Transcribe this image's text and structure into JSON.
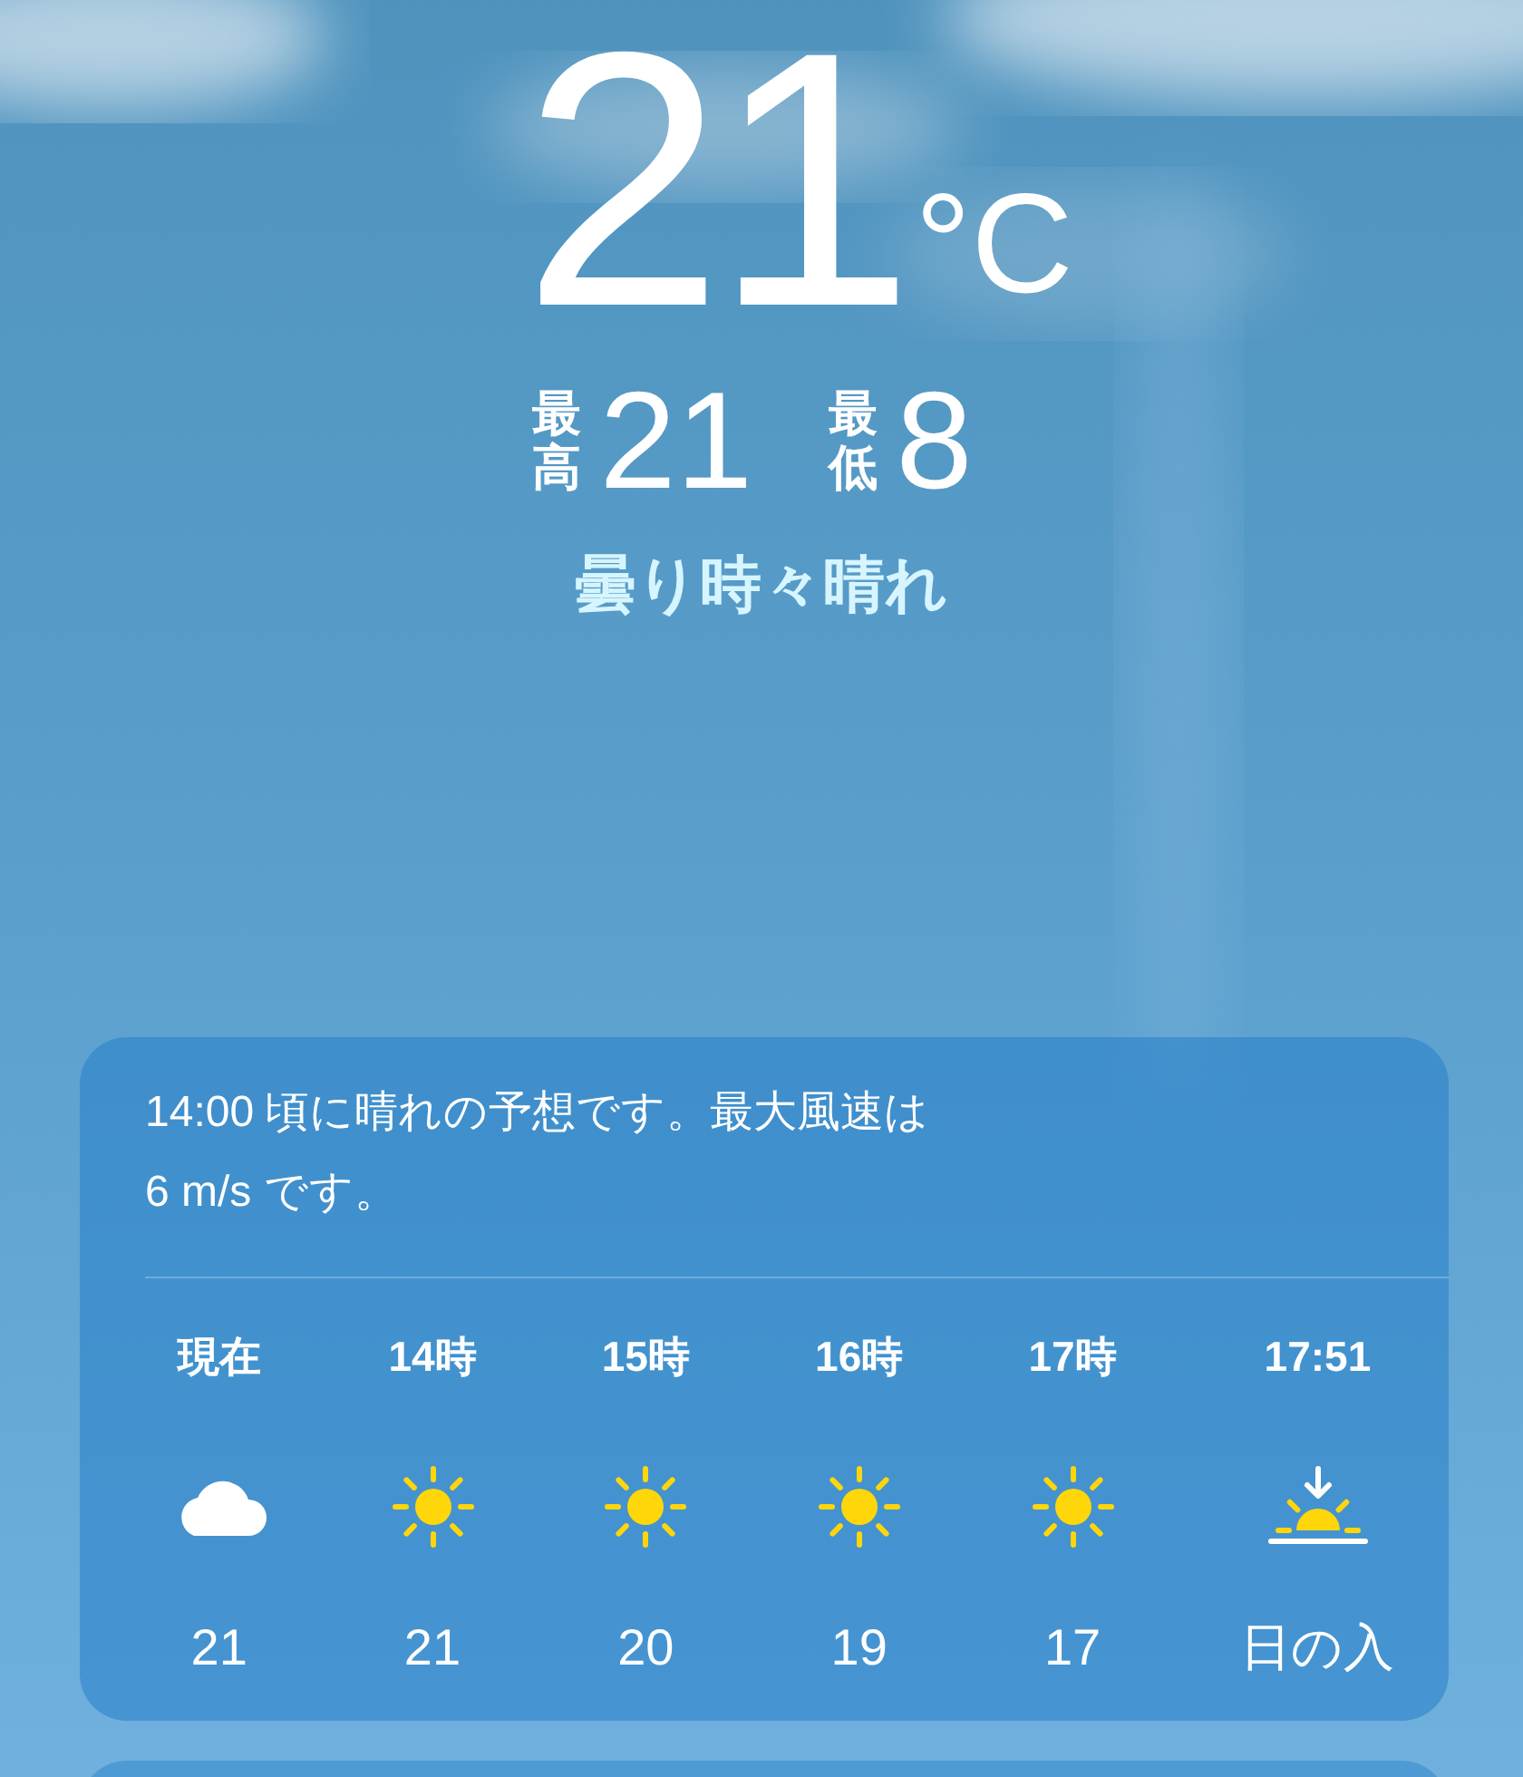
{
  "current": {
    "temperature": "21",
    "unit": "°C",
    "high_label": "最高",
    "high": "21",
    "low_label": "最低",
    "low": "8",
    "condition": "曇り時々晴れ"
  },
  "hourly_card": {
    "summary": "14:00 頃に晴れの予想です。最大風速は 6 m/s です。",
    "hours": [
      {
        "label": "現在",
        "kind": "cloud",
        "value": "21"
      },
      {
        "label": "14時",
        "kind": "sun",
        "value": "21"
      },
      {
        "label": "15時",
        "kind": "sun",
        "value": "20"
      },
      {
        "label": "16時",
        "kind": "sun",
        "value": "19"
      },
      {
        "label": "17時",
        "kind": "sun",
        "value": "17"
      },
      {
        "label": "17:51",
        "kind": "sunset",
        "value": "日の入"
      }
    ]
  }
}
